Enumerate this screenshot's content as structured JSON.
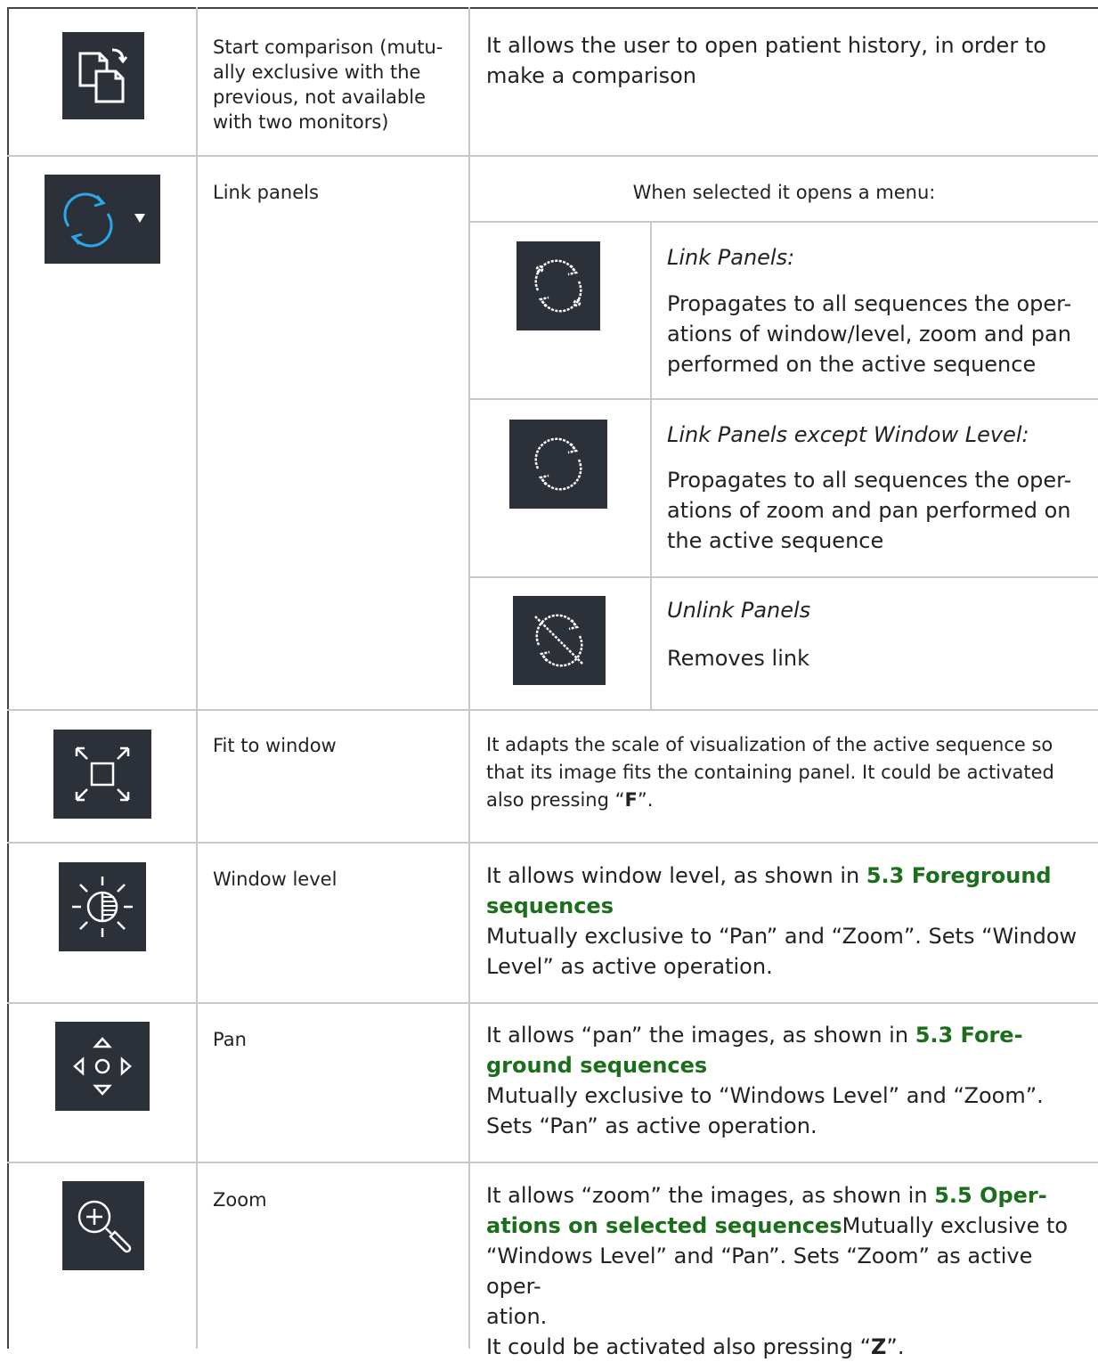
{
  "rows": [
    {
      "name": "Start comparison (mutually exclusive with the previous, not available with two monitors)",
      "name_lines": [
        "Start comparison (mutu-",
        "ally exclusive with the",
        "previous, not available",
        "with two monitors)"
      ],
      "icon": "start-comparison-icon",
      "description": "It allows the user to open patient history, in order to make a comparison"
    },
    {
      "name": "Link panels",
      "icon": "link-panels-dropdown-icon",
      "menu_intro": "When selected it opens a menu:",
      "submenu": [
        {
          "icon": "link-panels-icon",
          "title": "Link Panels:",
          "description": "Propagates to all sequences the operations of window/level, zoom and pan performed on the active sequence",
          "lines": [
            "Propagates to all sequences the oper-",
            "ations of window/level, zoom and pan",
            "performed on the active sequence"
          ]
        },
        {
          "icon": "link-panels-except-window-level-icon",
          "title": "Link Panels except Window Level:",
          "description": "Propagates to all sequences the operations of zoom and pan performed on the active sequence",
          "lines": [
            "Propagates to all sequences the oper-",
            "ations of zoom and pan performed on",
            "the active sequence"
          ]
        },
        {
          "icon": "unlink-panels-icon",
          "title": "Unlink Panels",
          "description": "Removes link"
        }
      ]
    },
    {
      "name": "Fit to window",
      "icon": "fit-to-window-icon",
      "description_lines": [
        "It adapts the scale of visualization of the active sequence so",
        "that its image fits the containing panel. It could be activated",
        "also pressing “"
      ],
      "key": "F",
      "key_suffix": "”."
    },
    {
      "name": "Window level",
      "icon": "window-level-icon",
      "prefix": "It allows window level, as shown in ",
      "link_part1": "5.3 Foreground",
      "link_part2": "sequences",
      "lines": [
        "Mutually exclusive to “Pan” and “Zoom”. Sets “Window",
        "Level” as active operation."
      ]
    },
    {
      "name": "Pan",
      "icon": "pan-icon",
      "prefix": "It allows “pan” the images, as shown in ",
      "link_part1": "5.3 Fore-",
      "link_part2": "ground sequences",
      "lines": [
        "Mutually exclusive to “Windows Level” and “Zoom”.",
        "Sets “Pan” as active operation."
      ]
    },
    {
      "name": "Zoom",
      "icon": "zoom-icon",
      "prefix": "It allows “zoom” the images, as shown in ",
      "link_part1": "5.5 Oper-",
      "link_part2": "ations on selected sequences",
      "after_link": "Mutually exclusive to",
      "lines": [
        "“Windows Level” and “Pan”. Sets “Zoom” as active oper-",
        "ation."
      ],
      "shortcut_prefix": "It could be activated also pressing “",
      "key": "Z",
      "key_suffix": "”."
    }
  ],
  "colors": {
    "icon_bg": "#2c3038",
    "link_text": "#1b6e1b",
    "accent_blue": "#2aa7e8",
    "grid": "#c8c8c8"
  }
}
